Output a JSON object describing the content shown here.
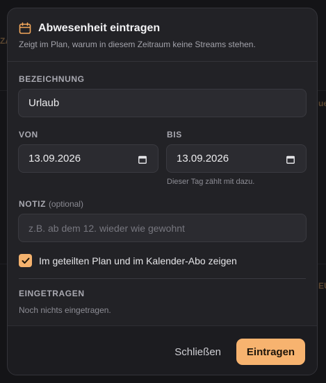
{
  "backdrop": {
    "peek_right_1": "ue",
    "peek_right_2": "EU",
    "peek_left": "ZA"
  },
  "dialog": {
    "icon": "calendar-icon",
    "title": "Abwesenheit eintragen",
    "subtitle": "Zeigt im Plan, warum in diesem Zeitraum keine Streams stehen."
  },
  "form": {
    "name_label": "BEZEICHNUNG",
    "name_value": "Urlaub",
    "from_label": "VON",
    "from_value": "13.09.2026",
    "to_label": "BIS",
    "to_value": "13.09.2026",
    "to_hint": "Dieser Tag zählt mit dazu.",
    "note_label": "NOTIZ",
    "note_optional": "(optional)",
    "note_placeholder": "z.B. ab dem 12. wieder wie gewohnt",
    "share_checked": true,
    "share_label": "Im geteilten Plan und im Kalender-Abo zeigen"
  },
  "existing": {
    "label": "EINGETRAGEN",
    "empty_text": "Noch nichts eingetragen."
  },
  "footer": {
    "close_label": "Schließen",
    "submit_label": "Eintragen"
  },
  "colors": {
    "accent": "#f7b36f",
    "surface": "#222226",
    "field": "#2b2b30"
  }
}
